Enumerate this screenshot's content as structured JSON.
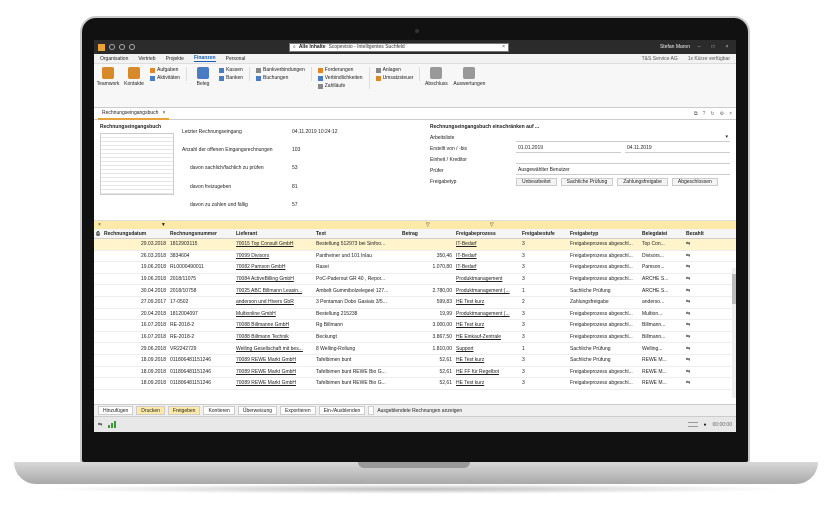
{
  "titlebar": {
    "search_scope": "Alle Inhalte",
    "search_value": "Scopevisio - Intelligentes Suchfeld",
    "user": "Stefan Maron"
  },
  "menu": {
    "items": [
      "Organisation",
      "Vertrieb",
      "Projekte",
      "Finanzen",
      "Personal"
    ],
    "active_index": 3,
    "company": "T&S Service AG",
    "notice": "1x Kürze verfügbar"
  },
  "ribbon": {
    "teamwork": "Teamwork",
    "kontakte": "Kontakte",
    "aufgaben": "Aufgaben",
    "aktivitaeten": "Aktivitäten",
    "belege": "Beleg",
    "kassen": "Kassen",
    "banken": "Banken",
    "bankverbindungen": "Bankverbindungen",
    "buchungen": "Buchungen",
    "forderungen": "Forderungen",
    "verbindlichkeiten": "Verbindlichkeiten",
    "zahllaeufe": "Zahlläufe",
    "anlagen": "Anlagen",
    "umsatzsteuer": "Umsatzsteuer",
    "abschluss": "Abschluss",
    "auswertungen": "Auswertungen"
  },
  "doctab": {
    "label": "Rechnungseingangsbuch"
  },
  "summary": {
    "title": "Rechnungseingangsbuch",
    "rows": [
      {
        "label": "Letzter Rechnungseingang",
        "value": "04.11.2019 10:24:12"
      },
      {
        "label": "Anzahl der offenen Eingangsrechnungen",
        "value": "103"
      },
      {
        "label": "davon sachlich/fachlich zu prüfen",
        "value": "53"
      },
      {
        "label": "davon freizugeben",
        "value": "81"
      },
      {
        "label": "davon zu zahlen und fällig",
        "value": "57"
      }
    ]
  },
  "filter": {
    "title": "Rechnungseingangsbuch einschränken auf ...",
    "arbeitsliste": "Arbeitsliste",
    "erstellt_label": "Erstellt von / -bis",
    "erstellt_from": "01.01.2019",
    "erstellt_to": "04.11.2019",
    "einheit_label": "Einheit / Kreditor",
    "pruefer_label": "Prüfer",
    "pruefer_value": "Ausgewählter Benutzer",
    "freigabetyp_label": "Freigabetyp",
    "freigabe_buttons": [
      "Unbearbeitet",
      "Sachliche Prüfung",
      "Zahlungsfreigabe",
      "Abgeschlossen"
    ]
  },
  "grid": {
    "headers": [
      "Rechnungsdatum",
      "Rechnungsnummer",
      "Lieferant",
      "Text",
      "Betrag",
      "Freigabeprozess",
      "Freigabestufe",
      "Freigabetyp",
      "Belegdatei",
      "Bezahlt"
    ],
    "rows": [
      [
        "29.03.2018",
        "1812903115",
        "70015 Top Consult GmbH",
        "Bestellung 512973 bei Sinfoo...",
        "",
        "IT-Bedarf",
        "3",
        "Freigabeprozess abgeschl...",
        "Top Con..."
      ],
      [
        "26.03.2018",
        "3834604",
        "70099 Divisors",
        "Pantheiner und 101 Inlau",
        "350,46",
        "IT-Bedarf",
        "3",
        "Freigabeprozess abgeschl...",
        "Divisors..."
      ],
      [
        "19.06.2018",
        "RL0000490011",
        "70082 Pamson GmbH",
        "Rasei",
        "1.070,80",
        "IT-Bedarf",
        "3",
        "Freigabeprozess abgeschl...",
        "Pamson..."
      ],
      [
        "19.06.2018",
        "2018/11075",
        "70084 ActiveBilling GmbH",
        "PoC-Paderout GR 40 , Repor...",
        "",
        "Produktmanagement",
        "3",
        "Freigabeprozess abgeschl...",
        "ARCHE S..."
      ],
      [
        "30.04.2018",
        "2018/10758",
        "70025 ABC Billmann Leasin...",
        "Ambelt Gummibolzelegeel 127...",
        "2.780,00",
        "Produktmanagement (...",
        "1",
        "Sachliche Prüfung",
        "ARCHE S..."
      ],
      [
        "27.09.2017",
        "17-0502",
        "anderson und Hivers GbR",
        "3 Pentaman Dobo Gasiais 3/5...",
        "599,83",
        "HE Test kurz",
        "2",
        "Zahlungsfreigabe",
        "anderso..."
      ],
      [
        "20.04.2018",
        "1812004097",
        "Multionline GmbH",
        "Bestellung 215238",
        "19,99",
        "Produktmanagement (...",
        "3",
        "Freigabeprozess abgeschl...",
        "Multion..."
      ],
      [
        "16.07.2018",
        "RE-2018-2",
        "70088 Billmanne GmbH",
        "Rg Billmann",
        "3.000,00",
        "HE Test kurz",
        "3",
        "Freigabeprozess abgeschl...",
        "Billmann..."
      ],
      [
        "16.07.2018",
        "RE-2018-2",
        "70088 Billmann Technik",
        "Beckungt",
        "3.867,50",
        "HE Einkauf-Zentrale",
        "3",
        "Freigabeprozess abgeschl...",
        "Billmann..."
      ],
      [
        "29.06.2018",
        "VR2242729",
        "Welling Gesellschaft mit bes...",
        "8 Welling-Rollung",
        "1.810,00",
        "Support",
        "1",
        "Sachliche Prüfung",
        "Welling..."
      ],
      [
        "18.09.2018",
        "011806481151246",
        "70089 REWE Markt GmbH",
        "Tafelbimen bunt",
        "52,61",
        "HE Test kurz",
        "3",
        "Sachliche Prüfung",
        "REWE M..."
      ],
      [
        "18.09.2018",
        "011806481151246",
        "70089 REWE Markt GmbH",
        "Tafelbimen bunt REWE Bio G...",
        "52,61",
        "HE FF für Regelbot",
        "3",
        "Freigabeprozess abgeschl...",
        "REWE M..."
      ],
      [
        "18.09.2018",
        "011806481151246",
        "70089 REWE Markt GmbH",
        "Tafelbimen bunt REWE Bio G...",
        "52,61",
        "HE Test kurz",
        "3",
        "Freigabeprozess abgeschl...",
        "REWE M..."
      ]
    ]
  },
  "bottombar": {
    "page": "Hinzufügen",
    "buttons": [
      "Drucken",
      "Freigeben",
      "Kontieren",
      "Überweisung",
      "Exportieren",
      "Ein-/Ausblenden"
    ],
    "checkbox_label": "Ausgeblendete Rechnungen anzeigen"
  },
  "statusbar": {
    "time": "00:00:00"
  }
}
